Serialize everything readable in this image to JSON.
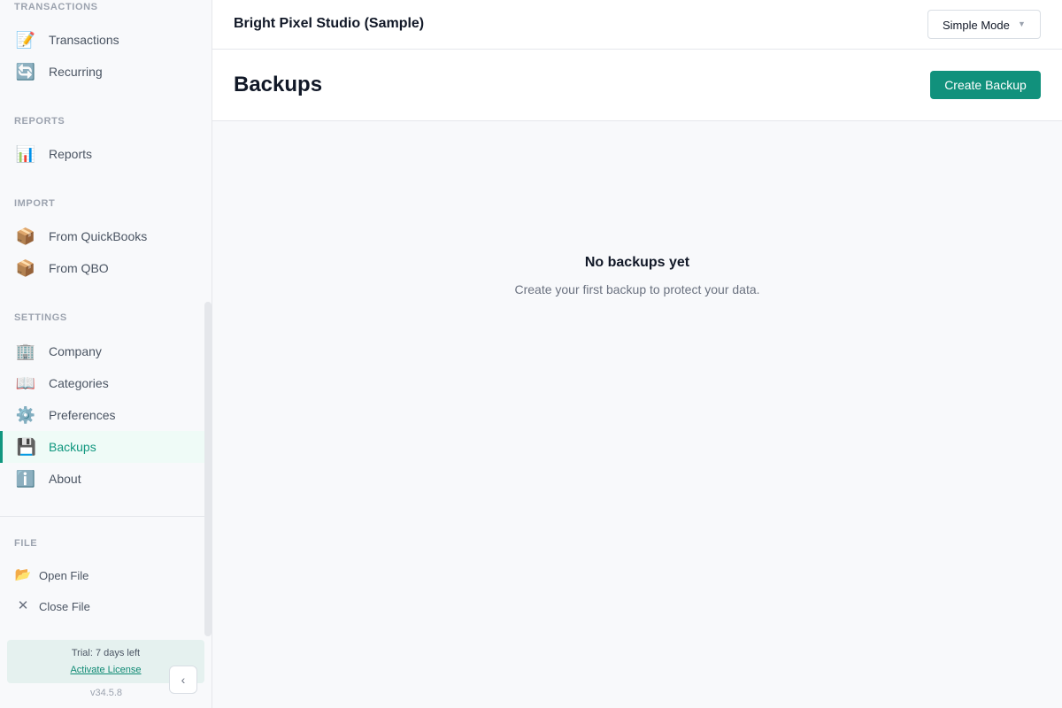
{
  "sidebar": {
    "sections": {
      "transactions": "TRANSACTIONS",
      "reports": "REPORTS",
      "import": "IMPORT",
      "settings": "SETTINGS",
      "file": "FILE"
    },
    "items": [
      {
        "label": "Transactions",
        "icon": "memo-icon",
        "glyph": "📝"
      },
      {
        "label": "Recurring",
        "icon": "repeat-icon",
        "glyph": "🔄"
      },
      {
        "label": "Reports",
        "icon": "bar-chart-icon",
        "glyph": "📊"
      },
      {
        "label": "From QuickBooks",
        "icon": "package-icon",
        "glyph": "📦"
      },
      {
        "label": "From QBO",
        "icon": "package-icon",
        "glyph": "📦"
      },
      {
        "label": "Company",
        "icon": "office-building-icon",
        "glyph": "🏢"
      },
      {
        "label": "Categories",
        "icon": "open-book-icon",
        "glyph": "📖"
      },
      {
        "label": "Preferences",
        "icon": "gear-icon",
        "glyph": "⚙️"
      },
      {
        "label": "Backups",
        "icon": "floppy-disk-icon",
        "glyph": "💾",
        "active": true
      },
      {
        "label": "About",
        "icon": "info-icon",
        "glyph": "ℹ️"
      }
    ],
    "file_items": [
      {
        "label": "Open File",
        "icon": "open-folder-icon",
        "glyph": "📂"
      },
      {
        "label": "Close File",
        "icon": "close-icon",
        "glyph": "✕"
      }
    ],
    "trial": {
      "text": "Trial: 7 days left",
      "link": "Activate License"
    },
    "version": "v34.5.8",
    "collapse_glyph": "‹"
  },
  "topbar": {
    "company": "Bright Pixel Studio (Sample)",
    "mode": "Simple Mode",
    "mode_chevron": "▼"
  },
  "page": {
    "title": "Backups",
    "create_button": "Create Backup"
  },
  "empty_state": {
    "title": "No backups yet",
    "description": "Create your first backup to protect your data."
  },
  "colors": {
    "accent": "#11917c",
    "active_bg": "#effbf7"
  }
}
